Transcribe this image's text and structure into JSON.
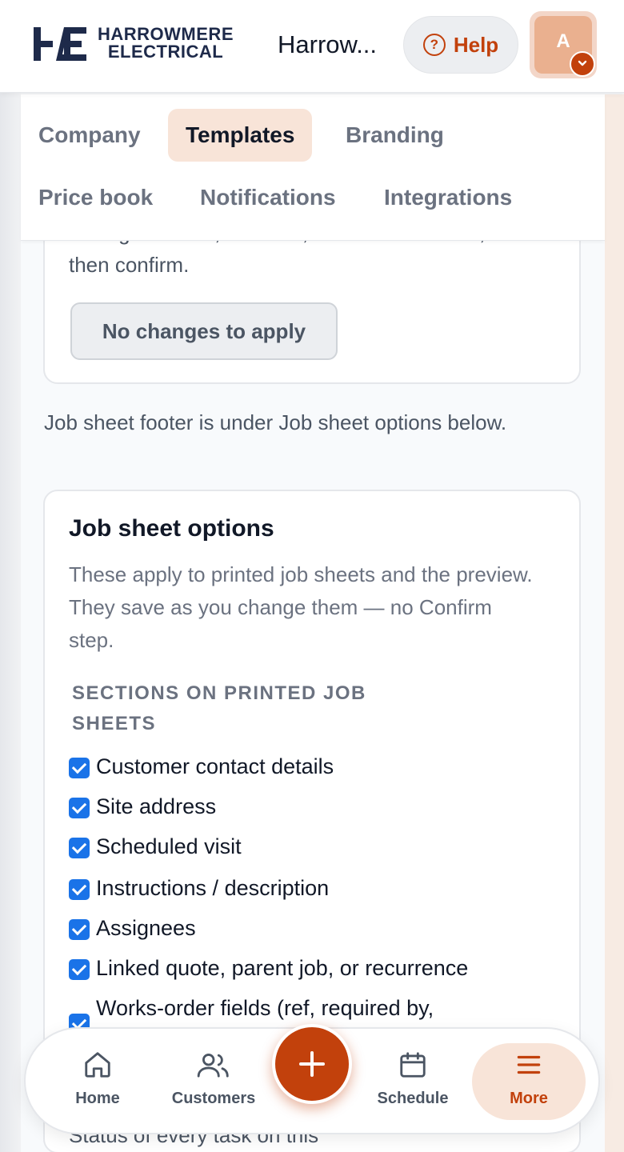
{
  "header": {
    "logo_line1": "HARROWMERE",
    "logo_line2": "ELECTRICAL",
    "logo_mark": "HE",
    "org_name": "Harrow...",
    "help_label": "Help",
    "avatar_initial": "A"
  },
  "tabs": [
    {
      "label": "Company",
      "active": false
    },
    {
      "label": "Templates",
      "active": true
    },
    {
      "label": "Branding",
      "active": false
    },
    {
      "label": "Price book",
      "active": false
    },
    {
      "label": "Notifications",
      "active": false
    },
    {
      "label": "Integrations",
      "active": false
    }
  ],
  "confirm_card": {
    "cut_text": "Change Classic, Detailed, or Branded above,",
    "confirm_text": "then confirm.",
    "button_label": "No changes to apply"
  },
  "footer_note": "Job sheet footer is under Job sheet options below.",
  "job_sheet_options": {
    "title": "Job sheet options",
    "description": "These apply to printed job sheets and the preview. They save as you change them — no Confirm step.",
    "section_label": "SECTIONS ON PRINTED JOB SHEETS",
    "checkboxes": [
      {
        "label": "Customer contact details",
        "checked": true
      },
      {
        "label": "Site address",
        "checked": true
      },
      {
        "label": "Scheduled visit",
        "checked": true
      },
      {
        "label": "Instructions / description",
        "checked": true
      },
      {
        "label": "Assignees",
        "checked": true
      },
      {
        "label": "Linked quote, parent job, or recurrence",
        "checked": true
      },
      {
        "label": "Works-order fields (ref, required by,",
        "checked": true
      }
    ],
    "partial_below": "Status of every task on this"
  },
  "bottom_nav": {
    "items": [
      {
        "label": "Home",
        "icon": "home-icon"
      },
      {
        "label": "Customers",
        "icon": "users-icon"
      },
      {
        "label": "Schedule",
        "icon": "calendar-icon"
      },
      {
        "label": "More",
        "icon": "menu-icon",
        "active": true
      }
    ],
    "fab_icon": "plus-icon"
  },
  "colors": {
    "accent": "#c2410c",
    "accent_soft": "#f8e4d8",
    "checkbox": "#1a73e8",
    "brand_navy": "#1e2a4a"
  }
}
